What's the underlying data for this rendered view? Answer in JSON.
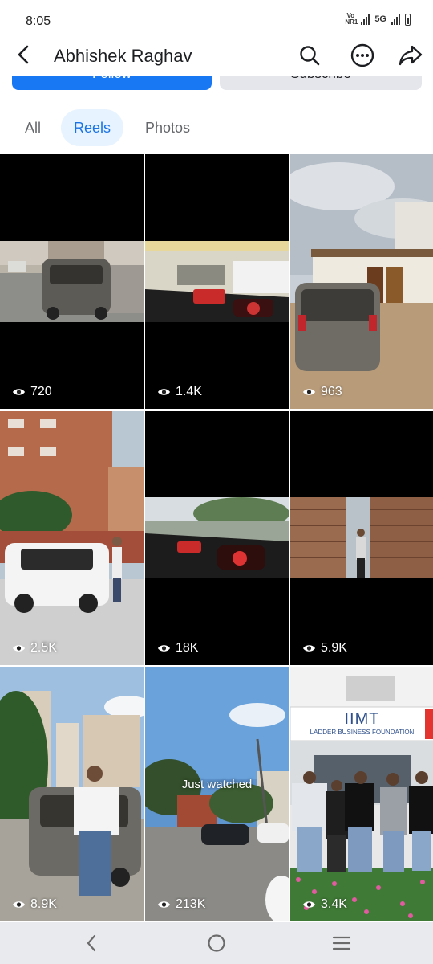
{
  "status_bar": {
    "time": "8:05",
    "volte": "Vo NR1",
    "network": "5G"
  },
  "header": {
    "title": "Abhishek Raghav"
  },
  "actions": {
    "follow_label": "Follow",
    "subscribe_label": "Subscribe"
  },
  "tabs": [
    {
      "label": "All",
      "selected": false
    },
    {
      "label": "Reels",
      "selected": true
    },
    {
      "label": "Photos",
      "selected": false
    }
  ],
  "reels": [
    {
      "views": "720",
      "subject": "grey hatchback parked by building"
    },
    {
      "views": "1.4K",
      "subject": "car dashboard at fuel station"
    },
    {
      "views": "963",
      "subject": "hatchback rear view near shed"
    },
    {
      "views": "2.5K",
      "subject": "white SUV in front of brick building"
    },
    {
      "views": "18K",
      "subject": "car dashboard on road"
    },
    {
      "views": "5.9K",
      "subject": "man at brown gate"
    },
    {
      "views": "8.9K",
      "subject": "man standing by car"
    },
    {
      "views": "213K",
      "subject": "street view",
      "overlay": "Just watched"
    },
    {
      "views": "3.4K",
      "subject": "group in front of IIMT building",
      "sign_text": "IIMT",
      "sign_subtext": "LADDER BUSINESS FOUNDATION"
    }
  ],
  "colors": {
    "accent": "#1877f2",
    "tab_selected_bg": "#e7f3ff",
    "tab_selected_text": "#1b74e4"
  }
}
